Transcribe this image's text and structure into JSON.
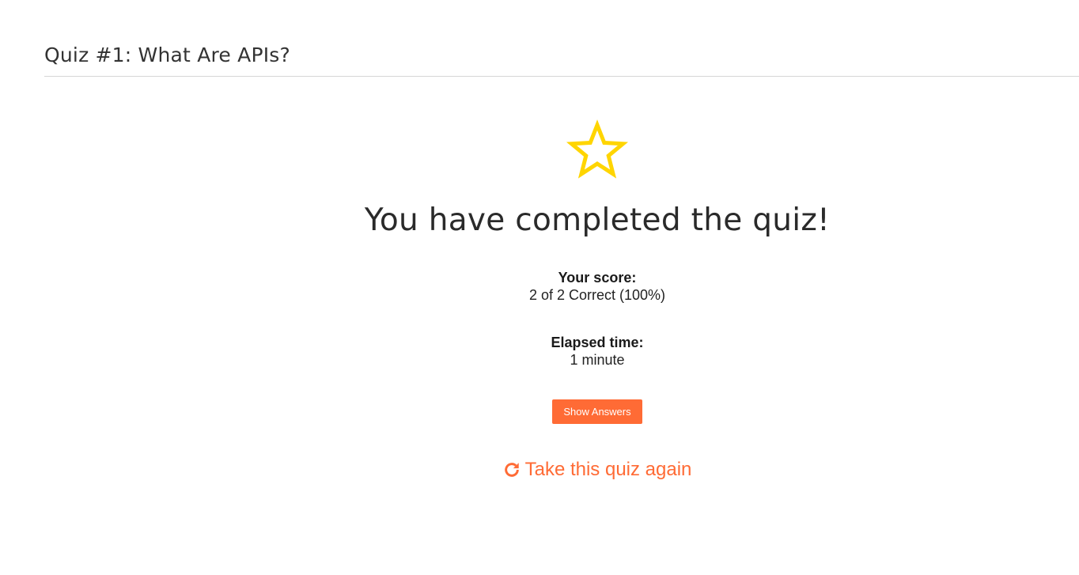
{
  "header": {
    "title": "Quiz #1: What Are APIs?"
  },
  "results": {
    "icon": "star-icon",
    "heading": "You have completed the quiz!",
    "score_label": "Your score:",
    "score_value": "2 of 2 Correct (100%)",
    "time_label": "Elapsed time:",
    "time_value": "1 minute",
    "show_answers_label": "Show Answers",
    "retake_icon": "refresh-icon",
    "retake_label": "Take this quiz again"
  },
  "colors": {
    "accent": "#ff6b35",
    "star": "#ffd500",
    "divider": "#d6d6d6"
  }
}
